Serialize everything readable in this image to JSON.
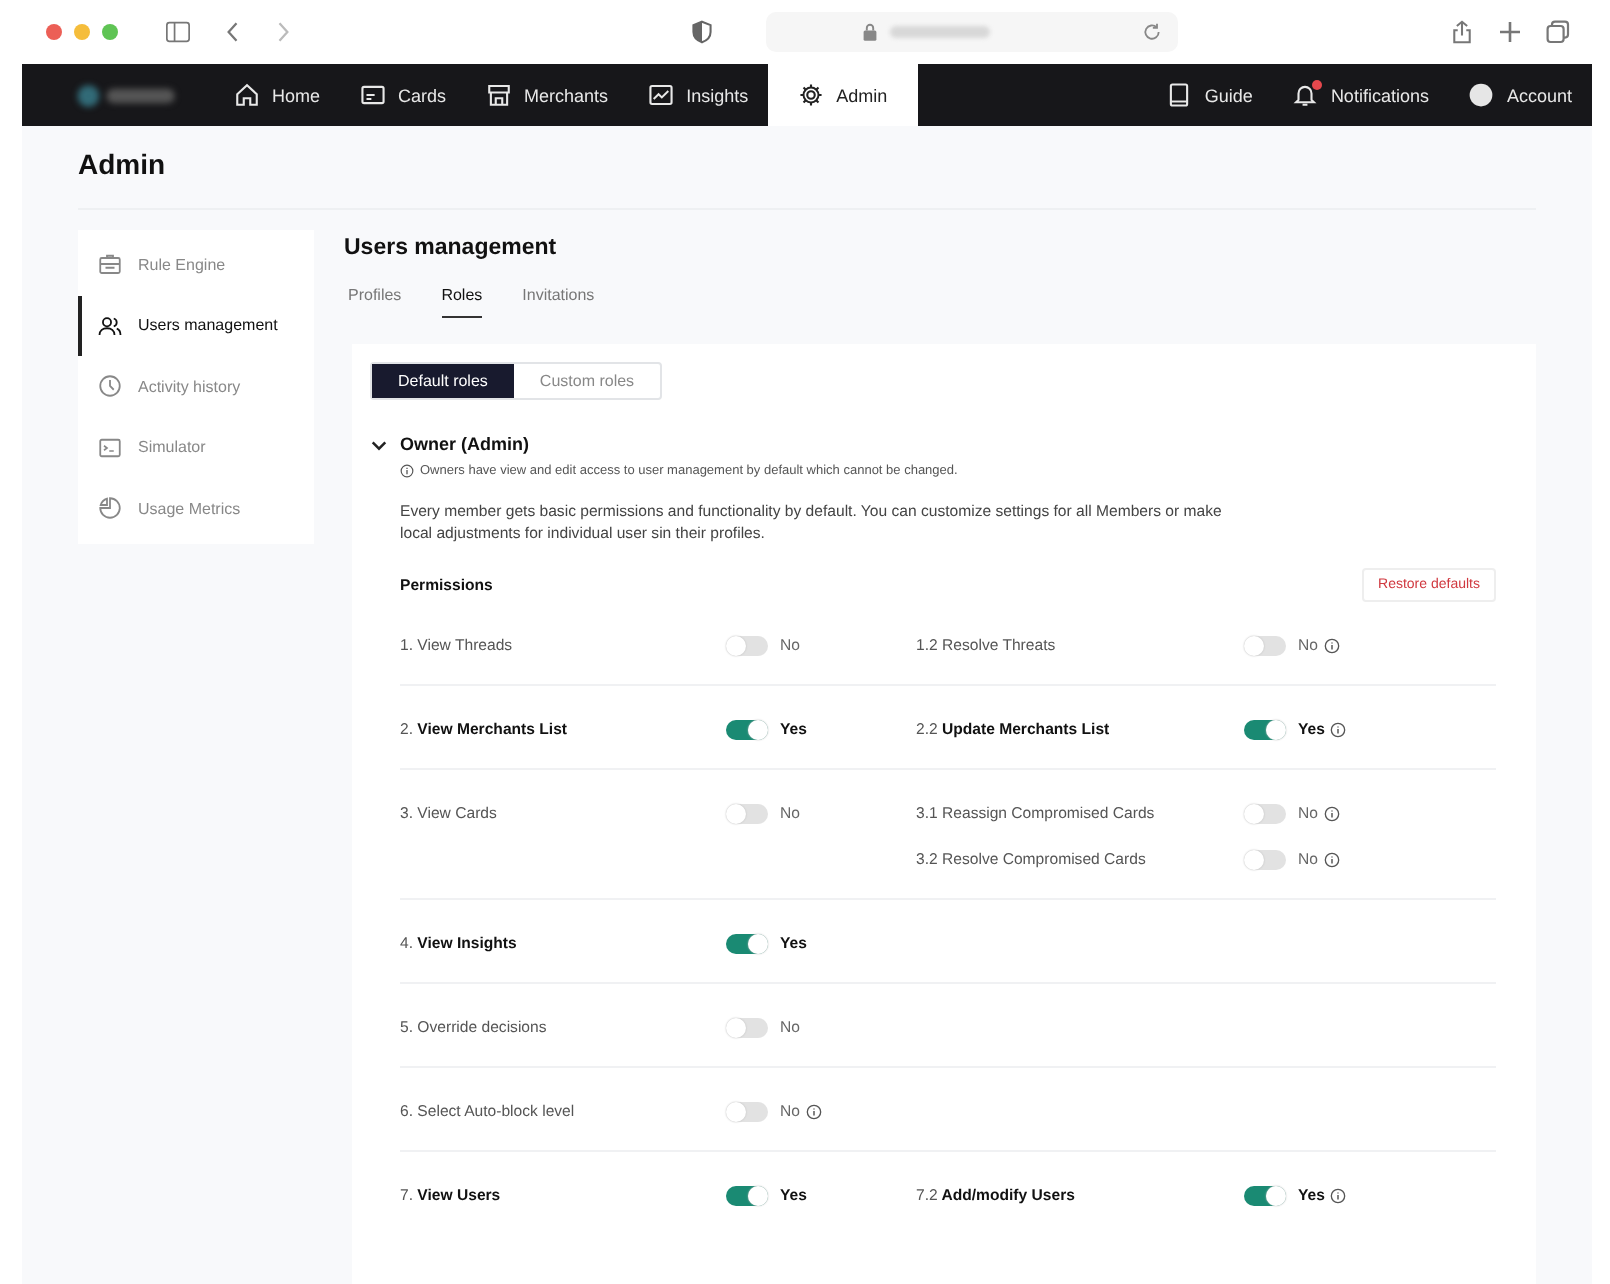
{
  "nav": {
    "items": [
      {
        "label": "Home",
        "selected": false
      },
      {
        "label": "Cards",
        "selected": false
      },
      {
        "label": "Merchants",
        "selected": false
      },
      {
        "label": "Insights",
        "selected": false
      },
      {
        "label": "Admin",
        "selected": true
      }
    ],
    "right": [
      {
        "label": "Guide",
        "badge": false
      },
      {
        "label": "Notifications",
        "badge": true
      },
      {
        "label": "Account",
        "badge": false
      }
    ]
  },
  "page_title": "Admin",
  "sidebar": {
    "items": [
      {
        "label": "Rule Engine",
        "selected": false
      },
      {
        "label": "Users management",
        "selected": true
      },
      {
        "label": "Activity history",
        "selected": false
      },
      {
        "label": "Simulator",
        "selected": false
      },
      {
        "label": "Usage Metrics",
        "selected": false
      }
    ]
  },
  "section_title": "Users management",
  "tabs": [
    {
      "label": "Profiles",
      "selected": false
    },
    {
      "label": "Roles",
      "selected": true
    },
    {
      "label": "Invitations",
      "selected": false
    }
  ],
  "role_switch": [
    {
      "label": "Default roles",
      "selected": true
    },
    {
      "label": "Custom roles",
      "selected": false
    }
  ],
  "role": {
    "title": "Owner (Admin)",
    "expanded": true,
    "note": "Owners have view and edit access to user management by default which cannot be changed.",
    "description": "Every member gets basic permissions and functionality by default. You can customize settings for all Members or make local adjustments for individual user sin their profiles."
  },
  "permissions_label": "Permissions",
  "restore_button": "Restore defaults",
  "groups": [
    {
      "number": "1.",
      "label": "View Threads",
      "on": false,
      "value": "No",
      "info": false,
      "subs": [
        {
          "number": "1.2",
          "label": "Resolve Threats",
          "on": false,
          "value": "No",
          "info": true
        }
      ]
    },
    {
      "number": "2.",
      "label": "View Merchants List",
      "on": true,
      "value": "Yes",
      "info": false,
      "subs": [
        {
          "number": "2.2",
          "label": "Update Merchants List",
          "on": true,
          "value": "Yes",
          "info": true
        }
      ]
    },
    {
      "number": "3.",
      "label": "View Cards",
      "on": false,
      "value": "No",
      "info": false,
      "subs": [
        {
          "number": "3.1",
          "label": "Reassign Compromised Cards",
          "on": false,
          "value": "No",
          "info": true
        },
        {
          "number": "3.2",
          "label": "Resolve Compromised Cards",
          "on": false,
          "value": "No",
          "info": true
        }
      ]
    },
    {
      "number": "4.",
      "label": "View Insights",
      "on": true,
      "value": "Yes",
      "info": false
    },
    {
      "number": "5.",
      "label": "Override decisions",
      "on": false,
      "value": "No",
      "info": false
    },
    {
      "number": "6.",
      "label": "Select Auto-block level",
      "on": false,
      "value": "No",
      "info": true
    },
    {
      "number": "7.",
      "label": "View Users",
      "on": true,
      "value": "Yes",
      "info": false,
      "subs": [
        {
          "number": "7.2",
          "label": "Add/modify Users",
          "on": true,
          "value": "Yes",
          "info": true
        }
      ]
    }
  ]
}
